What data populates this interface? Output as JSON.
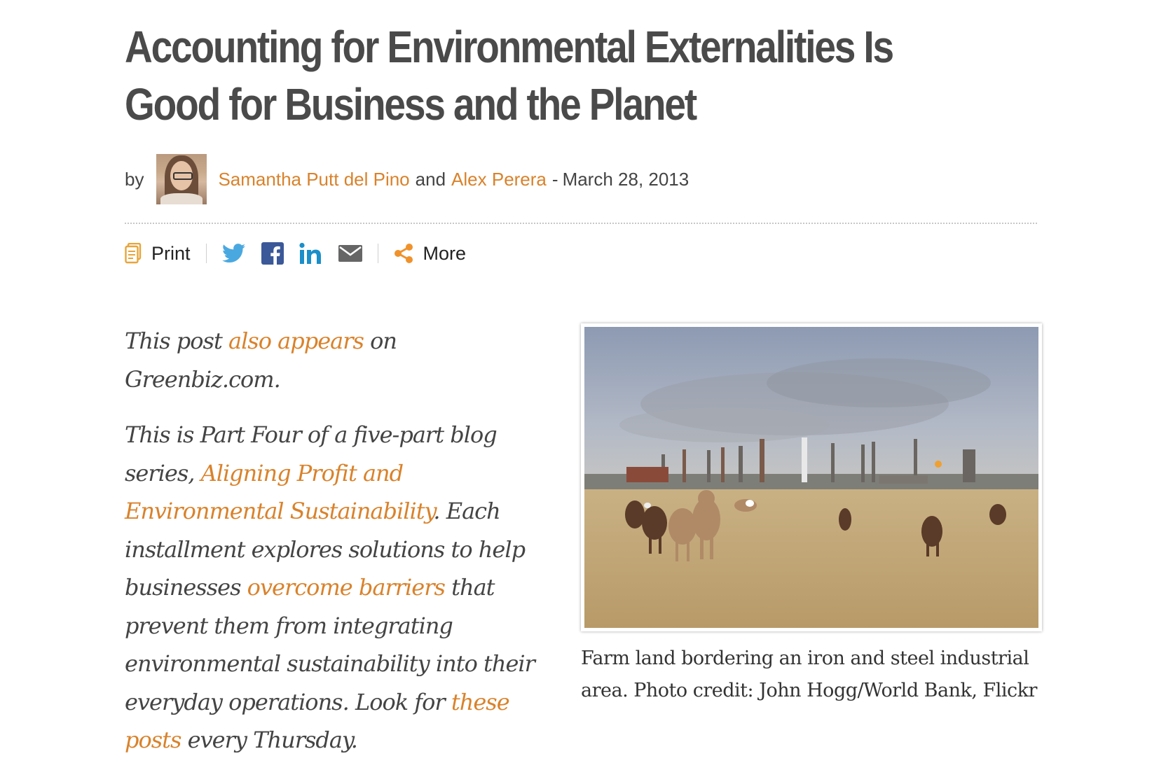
{
  "article": {
    "title": "Accounting for Environmental Externalities Is Good for Business and the Planet",
    "byline": {
      "prefix": "by",
      "author1": "Samantha Putt del Pino",
      "conjunction": "and",
      "author2": "Alex Perera",
      "separator": "-",
      "date": "March 28, 2013"
    }
  },
  "share_bar": {
    "print_label": "Print",
    "more_label": "More",
    "icons": [
      "print-icon",
      "twitter-icon",
      "facebook-icon",
      "linkedin-icon",
      "email-icon",
      "share-icon"
    ]
  },
  "body": {
    "p1": {
      "before": "This post ",
      "link": "also appears",
      "after": " on Greenbiz.com."
    },
    "p2": {
      "t1": "This is Part Four of a five-part blog series, ",
      "link1": "Aligning Profit and Environmental Sustainability",
      "t2": ". Each installment explores solutions to help businesses ",
      "link2": "overcome barriers",
      "t3": " that prevent them from integrating environmental sustainability into their everyday operations. Look for ",
      "link3": "these posts",
      "t4": " every Thursday."
    }
  },
  "figure": {
    "caption": "Farm land bordering an iron and steel industrial area. Photo credit: John Hogg/World Bank, Flickr"
  },
  "colors": {
    "link": "#d9822b",
    "title": "#4a4a4a",
    "text": "#444444"
  }
}
